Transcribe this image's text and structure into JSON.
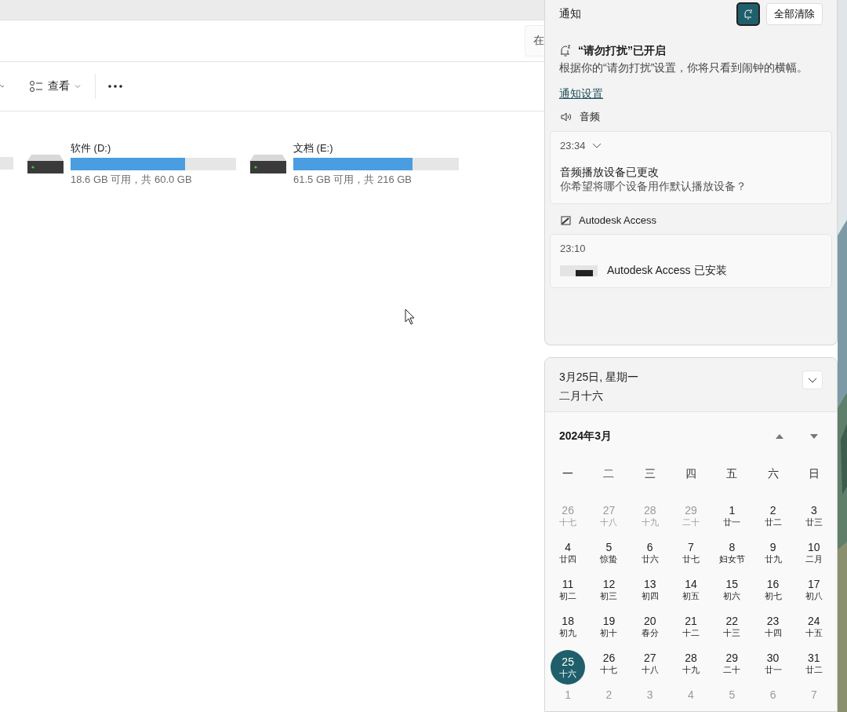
{
  "explorer": {
    "search_hint": "在",
    "view_label": "查看",
    "drives": [
      {
        "name": "软件 (D:)",
        "level": 0.69,
        "info": "18.6 GB 可用，共 60.0 GB"
      },
      {
        "name": "文档 (E:)",
        "level": 0.72,
        "info": "61.5 GB 可用，共 216 GB"
      }
    ]
  },
  "notifications": {
    "title": "通知",
    "focus_on": true,
    "clear_all": "全部清除",
    "dnd_title": "“请勿打扰”已开启",
    "dnd_text": "根据你的“请勿打扰”设置，你将只看到闹钟的横幅。",
    "settings_link": "通知设置",
    "groups": [
      {
        "app": "音频",
        "kind": "speaker",
        "items": [
          {
            "time": "23:34",
            "expandable": true,
            "title": "音频播放设备已更改",
            "body": "你希望将哪个设备用作默认播放设备？"
          }
        ]
      },
      {
        "app": "Autodesk Access",
        "kind": "app",
        "items": [
          {
            "time": "23:10",
            "expandable": false,
            "title": "Autodesk Access 已安装"
          }
        ]
      }
    ]
  },
  "calendar": {
    "date": "3月25日, 星期一",
    "lunar_date": "二月十六",
    "expanded": false,
    "month": "2024年3月",
    "weekdays": [
      "一",
      "二",
      "三",
      "四",
      "五",
      "六",
      "日"
    ],
    "days": [
      {
        "day": "26",
        "lunar": "十七",
        "muted": true,
        "selected": false
      },
      {
        "day": "27",
        "lunar": "十八",
        "muted": true,
        "selected": false
      },
      {
        "day": "28",
        "lunar": "十九",
        "muted": true,
        "selected": false
      },
      {
        "day": "29",
        "lunar": "二十",
        "muted": true,
        "selected": false
      },
      {
        "day": "1",
        "lunar": "廿一",
        "muted": false,
        "selected": false
      },
      {
        "day": "2",
        "lunar": "廿二",
        "muted": false,
        "selected": false
      },
      {
        "day": "3",
        "lunar": "廿三",
        "muted": false,
        "selected": false
      },
      {
        "day": "4",
        "lunar": "廿四",
        "muted": false,
        "selected": false
      },
      {
        "day": "5",
        "lunar": "惊蛰",
        "muted": false,
        "selected": false
      },
      {
        "day": "6",
        "lunar": "廿六",
        "muted": false,
        "selected": false
      },
      {
        "day": "7",
        "lunar": "廿七",
        "muted": false,
        "selected": false
      },
      {
        "day": "8",
        "lunar": "妇女节",
        "muted": false,
        "selected": false
      },
      {
        "day": "9",
        "lunar": "廿九",
        "muted": false,
        "selected": false
      },
      {
        "day": "10",
        "lunar": "二月",
        "muted": false,
        "selected": false
      },
      {
        "day": "11",
        "lunar": "初二",
        "muted": false,
        "selected": false
      },
      {
        "day": "12",
        "lunar": "初三",
        "muted": false,
        "selected": false
      },
      {
        "day": "13",
        "lunar": "初四",
        "muted": false,
        "selected": false
      },
      {
        "day": "14",
        "lunar": "初五",
        "muted": false,
        "selected": false
      },
      {
        "day": "15",
        "lunar": "初六",
        "muted": false,
        "selected": false
      },
      {
        "day": "16",
        "lunar": "初七",
        "muted": false,
        "selected": false
      },
      {
        "day": "17",
        "lunar": "初八",
        "muted": false,
        "selected": false
      },
      {
        "day": "18",
        "lunar": "初九",
        "muted": false,
        "selected": false
      },
      {
        "day": "19",
        "lunar": "初十",
        "muted": false,
        "selected": false
      },
      {
        "day": "20",
        "lunar": "春分",
        "muted": false,
        "selected": false
      },
      {
        "day": "21",
        "lunar": "十二",
        "muted": false,
        "selected": false
      },
      {
        "day": "22",
        "lunar": "十三",
        "muted": false,
        "selected": false
      },
      {
        "day": "23",
        "lunar": "十四",
        "muted": false,
        "selected": false
      },
      {
        "day": "24",
        "lunar": "十五",
        "muted": false,
        "selected": false
      },
      {
        "day": "25",
        "lunar": "十六",
        "muted": false,
        "selected": true
      },
      {
        "day": "26",
        "lunar": "十七",
        "muted": false,
        "selected": false
      },
      {
        "day": "27",
        "lunar": "十八",
        "muted": false,
        "selected": false
      },
      {
        "day": "28",
        "lunar": "十九",
        "muted": false,
        "selected": false
      },
      {
        "day": "29",
        "lunar": "二十",
        "muted": false,
        "selected": false
      },
      {
        "day": "30",
        "lunar": "廿一",
        "muted": false,
        "selected": false
      },
      {
        "day": "31",
        "lunar": "廿二",
        "muted": false,
        "selected": false
      },
      {
        "day": "1",
        "muted": true,
        "selected": false
      },
      {
        "day": "2",
        "muted": true,
        "selected": false
      },
      {
        "day": "3",
        "muted": true,
        "selected": false
      },
      {
        "day": "4",
        "muted": true,
        "selected": false
      },
      {
        "day": "5",
        "muted": true,
        "selected": false
      },
      {
        "day": "6",
        "muted": true,
        "selected": false
      },
      {
        "day": "7",
        "muted": true,
        "selected": false
      }
    ]
  }
}
